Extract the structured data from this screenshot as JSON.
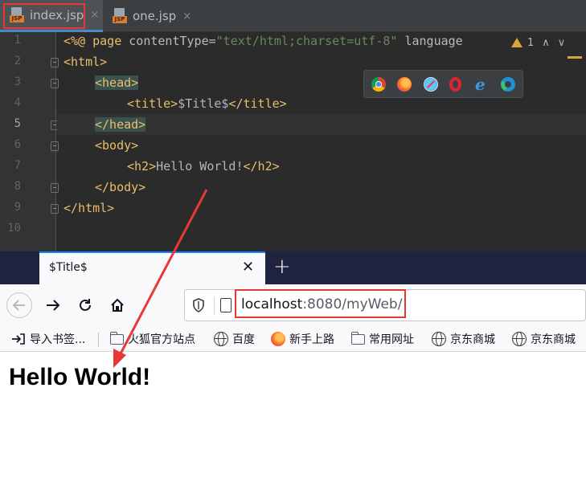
{
  "ide": {
    "tabs": [
      {
        "label": "index.jsp",
        "badge": "JSP",
        "close": "×"
      },
      {
        "label": "one.jsp",
        "badge": "JSP",
        "close": "×"
      }
    ],
    "line_numbers": [
      "1",
      "2",
      "3",
      "4",
      "5",
      "6",
      "7",
      "8",
      "9",
      "10"
    ],
    "current_line": "5",
    "inspection": {
      "warnings": "1",
      "up": "∧",
      "down": "∨"
    },
    "code": {
      "l1": {
        "open": "<%@ ",
        "directive": "page",
        "attr1": " contentType=",
        "val1": "\"text/html;charset=utf-8\"",
        "attr2": " language"
      },
      "l2": "<html>",
      "l3": "<head>",
      "l4": {
        "open": "<title>",
        "text": "$Title$",
        "close": "</title>"
      },
      "l5": "</head>",
      "l6": "<body>",
      "l7": {
        "open": "<h2>",
        "text": "Hello World!",
        "close": "</h2>"
      },
      "l8": "</body>",
      "l9": "</html>"
    },
    "browser_icons": [
      "chrome-icon",
      "firefox-icon",
      "safari-icon",
      "opera-icon",
      "ie-icon",
      "edge-icon"
    ]
  },
  "browser": {
    "tab_title": "$Title$",
    "tab_close": "✕",
    "new_tab": "+",
    "url_host": "localhost",
    "url_rest": ":8080/myWeb/",
    "bookmarks": [
      "导入书签...",
      "火狐官方站点",
      "百度",
      "新手上路",
      "常用网址",
      "京东商城",
      "京东商城"
    ],
    "page_heading": "Hello World!"
  },
  "colors": {
    "annotation_red": "#e53935",
    "ide_background": "#2b2b2b",
    "firefox_tabbar": "#202340",
    "tag_color": "#e8bf6a",
    "string_color": "#6a8759"
  }
}
